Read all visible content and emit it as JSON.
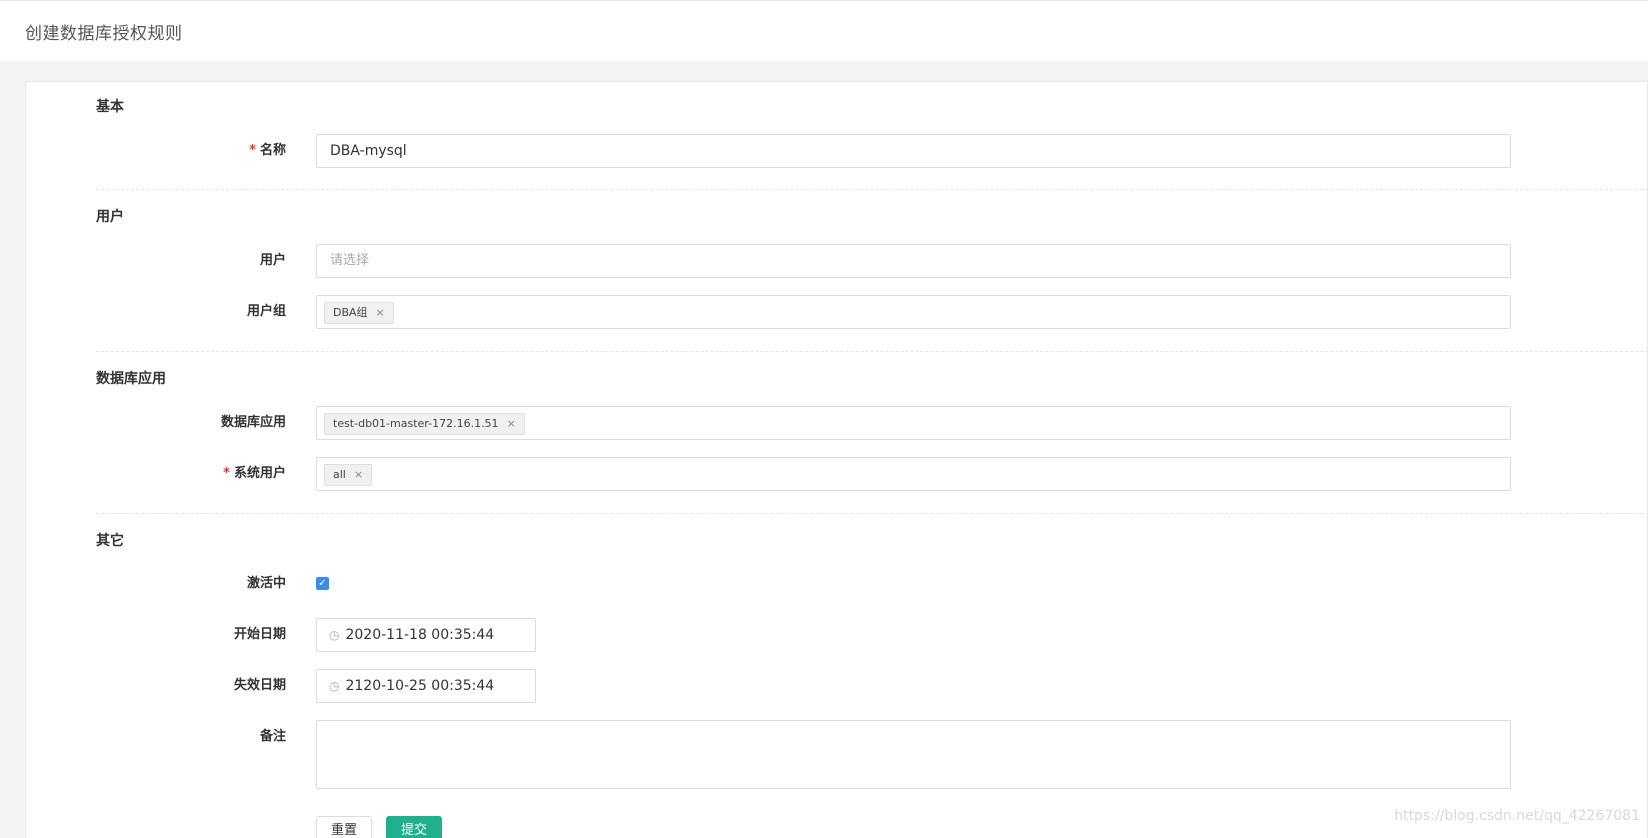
{
  "header": {
    "title": "创建数据库授权规则"
  },
  "sections": {
    "basic": {
      "title": "基本",
      "name_label": "名称",
      "name_value": "DBA-mysql"
    },
    "user": {
      "title": "用户",
      "user_label": "用户",
      "user_placeholder": "请选择",
      "group_label": "用户组",
      "group_tags": [
        "DBA组"
      ]
    },
    "database": {
      "title": "数据库应用",
      "app_label": "数据库应用",
      "app_tags": [
        "test-db01-master-172.16.1.51"
      ],
      "sysuser_label": "系统用户",
      "sysuser_tags": [
        "all"
      ]
    },
    "other": {
      "title": "其它",
      "active_label": "激活中",
      "active_checked": true,
      "start_label": "开始日期",
      "start_value": "2020-11-18 00:35:44",
      "expire_label": "失效日期",
      "expire_value": "2120-10-25 00:35:44",
      "remark_label": "备注",
      "remark_value": ""
    }
  },
  "buttons": {
    "reset": "重置",
    "submit": "提交"
  },
  "required_mark": "*",
  "tag_close": "×",
  "check_mark": "✓",
  "clock_glyph": "◷",
  "watermark": "https://blog.csdn.net/qq_42267081",
  "colors": {
    "accent": "#1fb18b",
    "checkbox": "#3a8ee6",
    "required": "#e4393c"
  }
}
